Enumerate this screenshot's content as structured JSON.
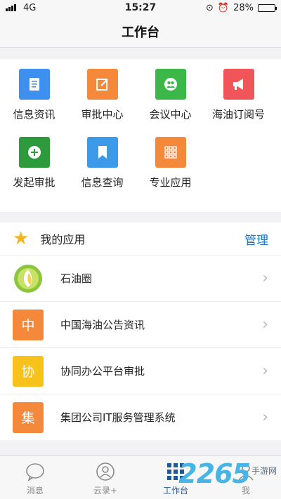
{
  "status_bar": {
    "network": "4G",
    "time": "15:27",
    "battery": "28%",
    "battery_level": 0.28
  },
  "nav": {
    "title": "工作台"
  },
  "grid": [
    {
      "label": "信息资讯",
      "icon": "document-icon",
      "color": "#3d8ff0"
    },
    {
      "label": "审批中心",
      "icon": "edit-note-icon",
      "color": "#f5893b"
    },
    {
      "label": "会议中心",
      "icon": "people-icon",
      "color": "#3cb84a"
    },
    {
      "label": "海油订阅号",
      "icon": "megaphone-icon",
      "color": "#f05659"
    },
    {
      "label": "发起审批",
      "icon": "plus-circle-icon",
      "color": "#2d9a3e"
    },
    {
      "label": "信息查询",
      "icon": "bookmark-icon",
      "color": "#3c9ae8"
    },
    {
      "label": "专业应用",
      "icon": "grid-dots-icon",
      "color": "#f5893b"
    }
  ],
  "my_apps": {
    "title": "我的应用",
    "manage_label": "管理",
    "items": [
      {
        "name": "石油圈",
        "icon": "shiyouquan-logo",
        "icon_text": "",
        "color": "#8cc63f"
      },
      {
        "name": "中国海油公告资讯",
        "icon": "char-icon",
        "icon_text": "中",
        "color": "#f5893b"
      },
      {
        "name": "协同办公平台审批",
        "icon": "char-icon",
        "icon_text": "协",
        "color": "#f7c21c"
      },
      {
        "name": "集团公司IT服务管理系统",
        "icon": "char-icon",
        "icon_text": "集",
        "color": "#f5893b"
      }
    ]
  },
  "tabs": [
    {
      "label": "消息",
      "icon": "chat-bubble-icon"
    },
    {
      "label": "云录+",
      "icon": "contacts-icon"
    },
    {
      "label": "工作台",
      "icon": "workbench-grid-icon",
      "active": true
    },
    {
      "label": "我",
      "icon": "user-icon"
    }
  ],
  "watermark": {
    "number": "2265",
    "suffix": "手游网"
  }
}
